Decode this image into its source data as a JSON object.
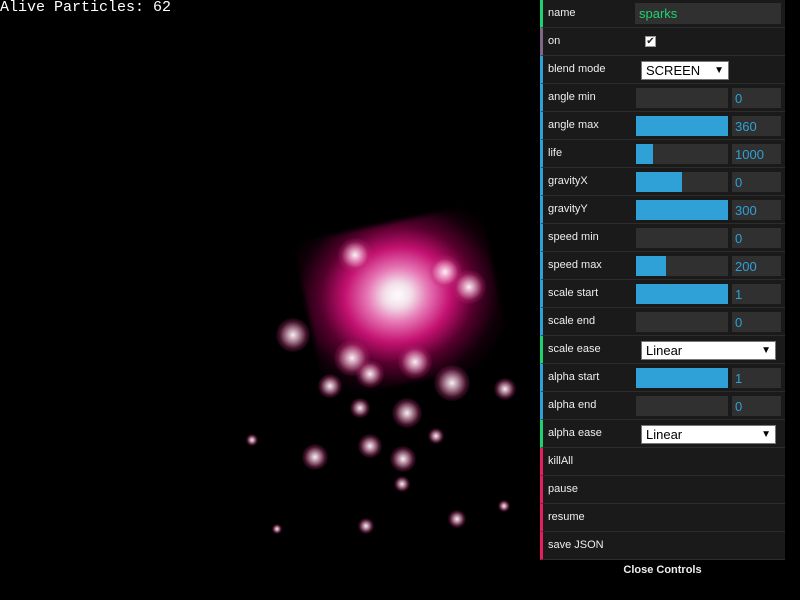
{
  "counter": {
    "label": "Alive Particles: 62"
  },
  "controls": {
    "name": {
      "label": "name",
      "value": "sparks"
    },
    "on": {
      "label": "on",
      "checked": true
    },
    "blend_mode": {
      "label": "blend mode",
      "value": "SCREEN"
    },
    "angle_min": {
      "label": "angle min",
      "value": "0",
      "fill": 0
    },
    "angle_max": {
      "label": "angle max",
      "value": "360",
      "fill": 1.0
    },
    "life": {
      "label": "life",
      "value": "1000",
      "fill": 0.18
    },
    "gravityX": {
      "label": "gravityX",
      "value": "0",
      "fill": 0.5
    },
    "gravityY": {
      "label": "gravityY",
      "value": "300",
      "fill": 1.0
    },
    "speed_min": {
      "label": "speed min",
      "value": "0",
      "fill": 0
    },
    "speed_max": {
      "label": "speed max",
      "value": "200",
      "fill": 0.33
    },
    "scale_start": {
      "label": "scale start",
      "value": "1",
      "fill": 1.0
    },
    "scale_end": {
      "label": "scale end",
      "value": "0",
      "fill": 0
    },
    "scale_ease": {
      "label": "scale ease",
      "value": "Linear"
    },
    "alpha_start": {
      "label": "alpha start",
      "value": "1",
      "fill": 1.0
    },
    "alpha_end": {
      "label": "alpha end",
      "value": "0",
      "fill": 0
    },
    "alpha_ease": {
      "label": "alpha ease",
      "value": "Linear"
    },
    "killAll": {
      "label": "killAll"
    },
    "pause": {
      "label": "pause"
    },
    "resume": {
      "label": "resume"
    },
    "save_json": {
      "label": "save JSON"
    },
    "close": {
      "label": "Close Controls"
    }
  },
  "colors": {
    "number": "#2fa1d6",
    "string": "#1ed36f",
    "boolean": "#806787",
    "function": "#e61d5f",
    "panel_bg": "#1a1a1a",
    "particle": "#f0148c"
  }
}
